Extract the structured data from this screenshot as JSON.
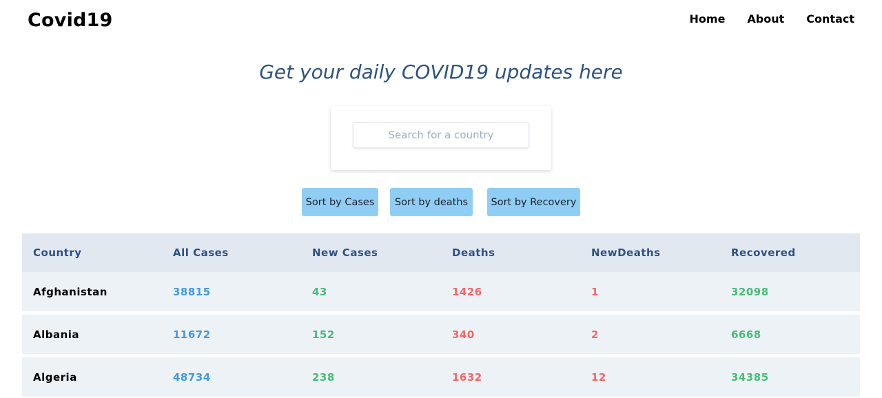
{
  "navbar": {
    "brand": "Covid19",
    "links": [
      "Home",
      "About",
      "Contact"
    ]
  },
  "headline": "Get your daily COVID19 updates here",
  "search": {
    "placeholder": "Search for a country",
    "value": ""
  },
  "sort_buttons": [
    "Sort by Cases",
    "Sort by deaths",
    "Sort by Recovery"
  ],
  "colors": {
    "headline": "#2c5282",
    "button": "#90cdf4",
    "all_cases": "#4299e1",
    "new_cases": "#48bb78",
    "deaths": "#f56565",
    "new_deaths": "#f56565",
    "recovered": "#48bb78"
  },
  "table": {
    "headers": [
      "Country",
      "All Cases",
      "New Cases",
      "Deaths",
      "NewDeaths",
      "Recovered"
    ],
    "rows": [
      {
        "country": "Afghanistan",
        "all_cases": "38815",
        "new_cases": "43",
        "deaths": "1426",
        "new_deaths": "1",
        "recovered": "32098"
      },
      {
        "country": "Albania",
        "all_cases": "11672",
        "new_cases": "152",
        "deaths": "340",
        "new_deaths": "2",
        "recovered": "6668"
      },
      {
        "country": "Algeria",
        "all_cases": "48734",
        "new_cases": "238",
        "deaths": "1632",
        "new_deaths": "12",
        "recovered": "34385"
      }
    ]
  }
}
